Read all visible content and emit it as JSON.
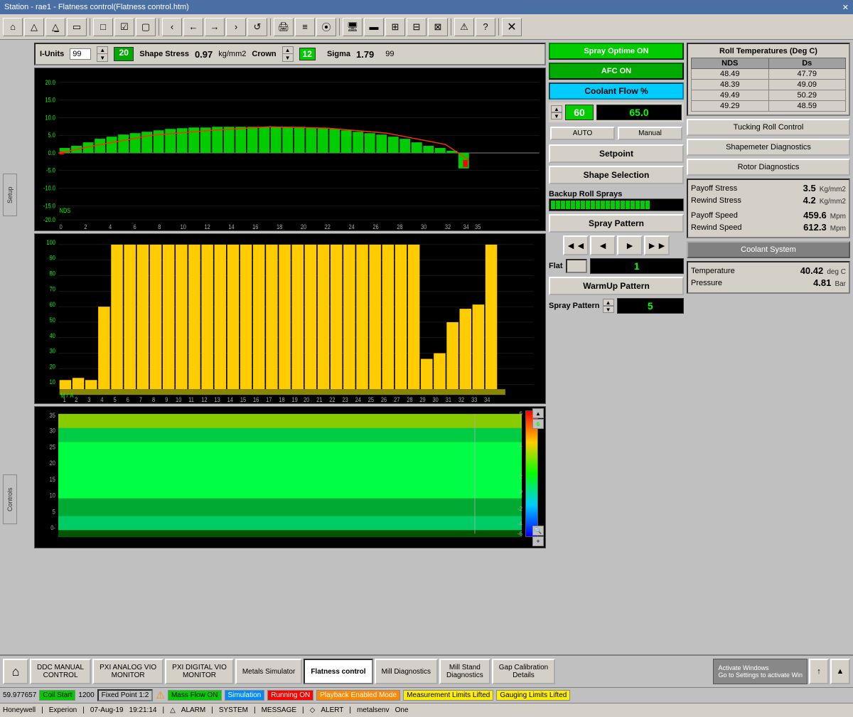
{
  "title": "Station - rae1 - Flatness control(Flatness control.htm)",
  "toolbar": {
    "buttons": [
      "home",
      "triangle",
      "triangle2",
      "monitor",
      "square",
      "checkbox",
      "square2",
      "chevron-left",
      "chevron-right",
      "undo",
      "print",
      "list",
      "bars",
      "nodes",
      "monitor2",
      "monitor3",
      "grid",
      "grid2",
      "grid3",
      "warning",
      "help",
      "close"
    ]
  },
  "top_controls": {
    "i_units_label": "I-Units",
    "i_units_val": "99",
    "shape_stress_label": "Shape Stress",
    "shape_stress_val": "0.97",
    "shape_stress_unit": "kg/mm2",
    "crown_label": "Crown",
    "crown_val": "12",
    "sigma_label": "Sigma",
    "sigma_val": "1.79",
    "sigma_right": "99",
    "set_val": "20"
  },
  "spray_ctrl": {
    "spray_optime_label": "Spray Optime ON",
    "afc_on_label": "AFC ON",
    "coolant_flow_label": "Coolant Flow %",
    "coolant_set": "60",
    "coolant_actual": "65.0",
    "auto_label": "AUTO",
    "manual_label": "Manual",
    "setpoint_label": "Setpoint",
    "shape_sel_label": "Shape Selection",
    "backup_roll_label": "Backup Roll Sprays",
    "spray_pattern_label": "Spray Pattern",
    "nav_btns": [
      "◄◄",
      "◄",
      "►",
      "►►"
    ],
    "flat_label": "Flat",
    "flat_val": "1",
    "warmup_label": "WarmUp Pattern",
    "spray_pattern_row_label": "Spray Pattern",
    "spray_pattern_val": "5"
  },
  "roll_temps": {
    "title": "Roll Temperatures (Deg C)",
    "col1": "NDS",
    "col2": "Ds",
    "rows": [
      {
        "nds": "48.49",
        "ds": "47.79"
      },
      {
        "nds": "48.39",
        "ds": "49.09"
      },
      {
        "nds": "49.49",
        "ds": "50.29"
      },
      {
        "nds": "49.29",
        "ds": "48.59"
      }
    ]
  },
  "right_btns": {
    "tucking_roll": "Tucking Roll Control",
    "shapemeter": "Shapemeter Diagnostics",
    "rotor": "Rotor Diagnostics"
  },
  "stats": {
    "payoff_stress_label": "Payoff Stress",
    "payoff_stress_val": "3.5",
    "payoff_stress_unit": "Kg/mm2",
    "rewind_stress_label": "Rewind Stress",
    "rewind_stress_val": "4.2",
    "rewind_stress_unit": "Kg/mm2",
    "payoff_speed_label": "Payoff Speed",
    "payoff_speed_val": "459.6",
    "payoff_speed_unit": "Mpm",
    "rewind_speed_label": "Rewind Speed",
    "rewind_speed_val": "612.3",
    "rewind_speed_unit": "Mpm",
    "coolant_sys_label": "Coolant System",
    "temp_label": "Temperature",
    "temp_val": "40.42",
    "temp_unit": "deg C",
    "pressure_label": "Pressure",
    "pressure_val": "4.81",
    "pressure_unit": "Bar"
  },
  "taskbar": {
    "items": [
      {
        "label": "DDC MANUAL\nCONTROL",
        "active": false
      },
      {
        "label": "PXI ANALOG VIO\nMONITOR",
        "active": false
      },
      {
        "label": "PXI DIGITAL VIO\nMONITOR",
        "active": false
      },
      {
        "label": "Metals Simulator",
        "active": false
      },
      {
        "label": "Flatness control",
        "active": true
      },
      {
        "label": "Mill Diagnostics",
        "active": false
      },
      {
        "label": "Mill Stand\nDiagnostics",
        "active": false
      },
      {
        "label": "Gap Calibration\nDetails",
        "active": false
      }
    ]
  },
  "info_bar": {
    "time_val": "59.977657",
    "coil_label": "Coil Start",
    "coil_val": "1200",
    "fixed_point_label": "Fixed Point 1:2",
    "mass_flow_label": "Mass Flow ON",
    "simulation_label": "Simulation",
    "running_label": "Running ON",
    "playback_label": "Playback Enabled Mode",
    "meas_limits_label": "Measurement Limits Lifted",
    "gauging_limits_label": "Gauging Limits Lifted"
  },
  "status_bar": {
    "company1": "Honeywell",
    "company2": "Experion",
    "date": "07-Aug-19",
    "time": "19:21:14",
    "alarm_label": "ALARM",
    "system_label": "SYSTEM",
    "message_label": "MESSAGE",
    "alert_label": "ALERT",
    "company3": "metalsenv",
    "version": "One"
  },
  "shape_chart": {
    "y_labels": [
      "20.0",
      "15.0",
      "10.0",
      "5.0",
      "0.0",
      "-5.0",
      "-10.0",
      "-15.0",
      "-20.0"
    ],
    "x_labels": [
      "0",
      "2",
      "4",
      "6",
      "8",
      "10",
      "12",
      "14",
      "16",
      "18",
      "20",
      "22",
      "24",
      "26",
      "28",
      "30",
      "32",
      "34",
      "35"
    ],
    "nds_label": "NDS"
  },
  "bar_chart": {
    "y_labels": [
      "100",
      "90",
      "80",
      "70",
      "60",
      "50",
      "40",
      "30",
      "20",
      "10"
    ],
    "x_labels": [
      "1",
      "2",
      "3",
      "4",
      "5",
      "6",
      "7",
      "8",
      "9",
      "10",
      "11",
      "12",
      "13",
      "14",
      "15",
      "16",
      "17",
      "18",
      "19",
      "20",
      "21",
      "22",
      "23",
      "24",
      "25",
      "26",
      "27",
      "28",
      "29",
      "30",
      "31",
      "32",
      "33",
      "34"
    ],
    "bar_heights": [
      10,
      12,
      10,
      55,
      85,
      95,
      95,
      95,
      95,
      95,
      95,
      95,
      95,
      95,
      95,
      95,
      95,
      95,
      95,
      95,
      95,
      95,
      95,
      95,
      95,
      95,
      95,
      95,
      18,
      22,
      45,
      55,
      60,
      95
    ],
    "m_label": "M",
    "a_label": "A"
  }
}
